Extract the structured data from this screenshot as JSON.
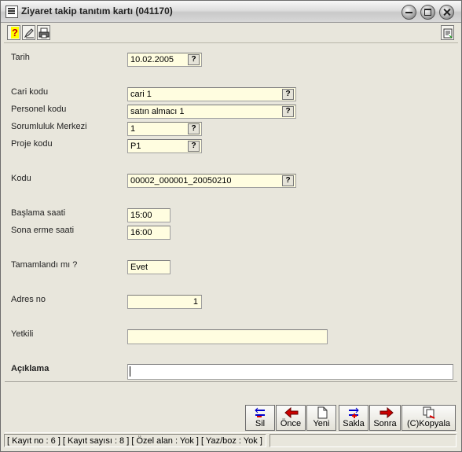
{
  "window": {
    "title": "Ziyaret takip tanıtım kartı (041170)"
  },
  "toolbar": {
    "icons": [
      "help-icon",
      "edit-icon",
      "print-icon",
      "refresh-icon"
    ]
  },
  "form": {
    "tarih": {
      "label": "Tarih",
      "value": "10.02.2005"
    },
    "cari_kodu": {
      "label": "Cari kodu",
      "value": "cari 1"
    },
    "personel_kodu": {
      "label": "Personel kodu",
      "value": "satın almacı 1"
    },
    "sorumluluk_merkezi": {
      "label": "Sorumluluk Merkezi",
      "value": "1"
    },
    "proje_kodu": {
      "label": "Proje kodu",
      "value": "P1"
    },
    "kodu": {
      "label": "Kodu",
      "value": "00002_000001_20050210"
    },
    "baslama_saati": {
      "label": "Başlama saati",
      "value": "15:00"
    },
    "sona_erme_saati": {
      "label": "Sona erme saati",
      "value": "16:00"
    },
    "tamamlandi": {
      "label": "Tamamlandı mı ?",
      "value": "Evet"
    },
    "adres_no": {
      "label": "Adres no",
      "value": "1"
    },
    "yetkili": {
      "label": "Yetkili",
      "value": ""
    },
    "aciklama": {
      "label": "Açıklama",
      "value": ""
    },
    "lookup_glyph": "?"
  },
  "buttons": {
    "sil": "Sil",
    "once": "Önce",
    "yeni": "Yeni",
    "sakla": "Sakla",
    "sonra": "Sonra",
    "kopyala": "(C)Kopyala"
  },
  "status": {
    "text": "[ Kayıt no : 6 ] [ Kayıt sayısı : 8 ] [ Özel alan : Yok ] [ Yaz/boz : Yok ]"
  },
  "colors": {
    "field_bg": "#fffde0",
    "window_bg": "#e8e6dc",
    "help_icon": "#ffff00"
  }
}
